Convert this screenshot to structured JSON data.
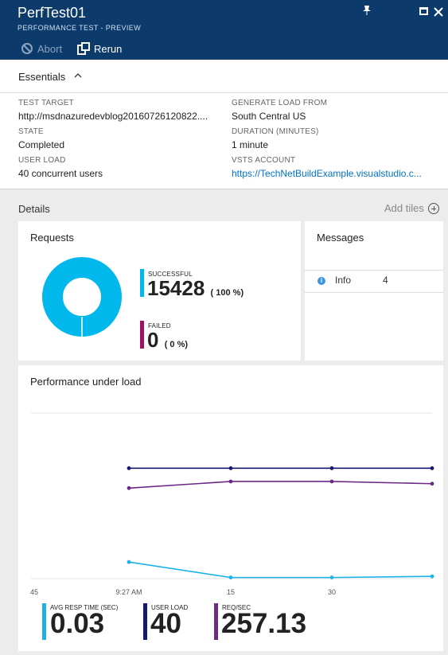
{
  "header": {
    "title": "PerfTest01",
    "subtitle": "PERFORMANCE TEST - PREVIEW",
    "abort_label": "Abort",
    "rerun_label": "Rerun"
  },
  "essentials": {
    "label": "Essentials",
    "left": [
      {
        "label": "TEST TARGET",
        "value": "http://msdnazuredevblog20160726120822...."
      },
      {
        "label": "STATE",
        "value": "Completed"
      },
      {
        "label": "USER LOAD",
        "value": "40 concurrent users"
      }
    ],
    "right": [
      {
        "label": "GENERATE LOAD FROM",
        "value": "South Central US"
      },
      {
        "label": "DURATION (MINUTES)",
        "value": "1 minute"
      },
      {
        "label": "VSTS ACCOUNT",
        "value": "https://TechNetBuildExample.visualstudio.c..."
      }
    ]
  },
  "details": {
    "label": "Details",
    "add_tiles_label": "Add tiles"
  },
  "requests": {
    "title": "Requests",
    "successful_label": "SUCCESSFUL",
    "successful_value": "15428",
    "successful_pct": "( 100 %)",
    "failed_label": "FAILED",
    "failed_value": "0",
    "failed_pct": "( 0 %)",
    "successful_fraction": 1.0
  },
  "messages": {
    "title": "Messages",
    "rows": [
      {
        "type": "Info",
        "count": "4"
      }
    ]
  },
  "performance": {
    "title": "Performance under load",
    "kpis": [
      {
        "label": "AVG RESP TIME (SEC)",
        "value": "0.03",
        "color": "#1ab2e8"
      },
      {
        "label": "USER LOAD",
        "value": "40",
        "color": "#141a6e"
      },
      {
        "label": "REQ/SEC",
        "value": "257.13",
        "color": "#6b2a86"
      }
    ]
  },
  "colors": {
    "header_bg": "#0b3a6b",
    "successful": "#00b8ec",
    "failed": "#a0115f",
    "link": "#0072c6"
  },
  "chart_data": {
    "type": "line",
    "x": [
      "45",
      "9:27 AM",
      "15",
      "30"
    ],
    "series": [
      {
        "color": "#141a6e",
        "values": [
          null,
          1.0,
          1.0,
          1.0,
          1.0
        ]
      },
      {
        "color": "#6b2a86",
        "values": [
          null,
          0.82,
          0.88,
          0.88,
          0.86
        ]
      },
      {
        "color": "#1ab2e8",
        "values": [
          null,
          0.15,
          0.01,
          0.01,
          0.02
        ]
      }
    ],
    "ylabel": "",
    "xlabel": "",
    "ylim": [
      0,
      1.5
    ],
    "grid": true
  }
}
